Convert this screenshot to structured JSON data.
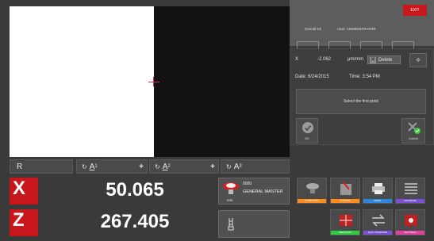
{
  "header": {
    "exit_label": "EXIT",
    "session": "Overall K5",
    "user": "User: ADMINISTRATOR"
  },
  "dialog": {
    "axis": "X",
    "value": "-2.062",
    "units": "μm/mm",
    "delete_label": "Delete",
    "date": "Date: 6/24/2015",
    "time": "Time: 3:54 PM",
    "prompt": "Select the first point",
    "ok_label": "OK",
    "cancel_label": "Cancel"
  },
  "angle_bar": {
    "r_label": "R",
    "a1_label": "A",
    "a1_sub": "1",
    "a2_label": "A",
    "a2_sub": "2",
    "a3_label": "A",
    "a3_sub": "3",
    "plus": "+"
  },
  "dro": {
    "x_axis": "X",
    "x_value": "50.065",
    "z_axis": "Z",
    "z_value": "267.405"
  },
  "master": {
    "code": "0000",
    "name": "GENERAL MASTER",
    "units": "mm"
  },
  "tiles": [
    {
      "label": "ID METHOD",
      "color": "#ff8c1a"
    },
    {
      "label": "FIXTURE",
      "color": "#ff8c1a"
    },
    {
      "label": "PRINT",
      "color": "#2e86de"
    },
    {
      "label": "DATABASE",
      "color": "#7b4fd6"
    },
    {
      "label": "METHODS",
      "color": "#2ecc40"
    },
    {
      "label": "DATA TRANSFER",
      "color": "#7b4fd6"
    },
    {
      "label": "SETTINGS",
      "color": "#e040a0"
    }
  ]
}
